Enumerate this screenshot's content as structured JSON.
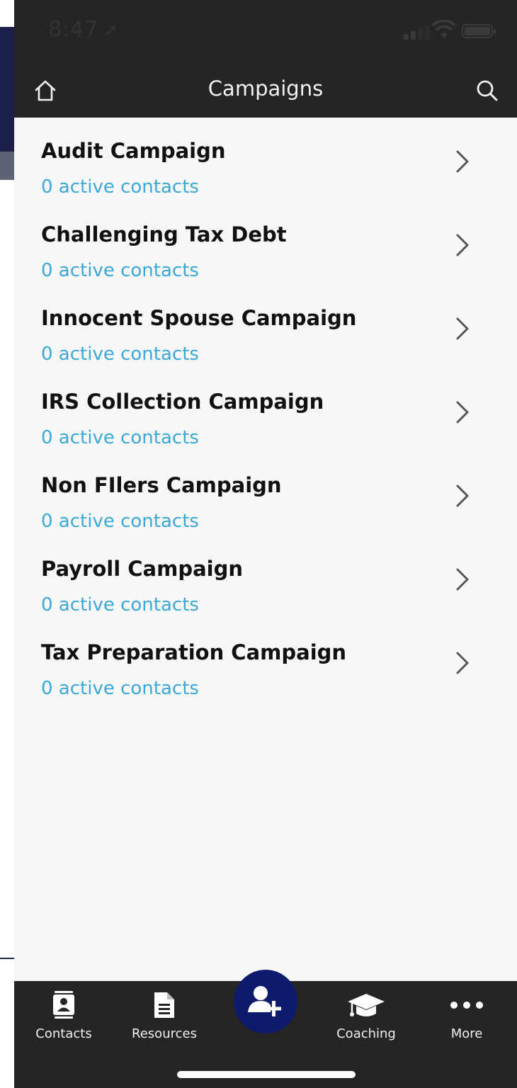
{
  "status_bar": {
    "time": "8:47",
    "location_glyph": "➚"
  },
  "nav": {
    "title": "Campaigns",
    "home_icon": "home-icon",
    "search_icon": "search-icon"
  },
  "campaigns": [
    {
      "name": "Audit Campaign",
      "subtitle": "0 active contacts"
    },
    {
      "name": "Challenging Tax Debt",
      "subtitle": "0 active contacts"
    },
    {
      "name": "Innocent Spouse Campaign",
      "subtitle": "0 active contacts"
    },
    {
      "name": "IRS Collection Campaign",
      "subtitle": "0 active contacts"
    },
    {
      "name": "Non FIlers Campaign",
      "subtitle": "0 active contacts"
    },
    {
      "name": "Payroll Campaign",
      "subtitle": "0 active contacts"
    },
    {
      "name": "Tax Preparation Campaign",
      "subtitle": "0 active contacts"
    }
  ],
  "tab_bar": {
    "contacts": "Contacts",
    "resources": "Resources",
    "coaching": "Coaching",
    "more": "More",
    "fab_icon": "add-contact-icon"
  },
  "colors": {
    "header_bg": "#252525",
    "list_bg": "#f8f7f8",
    "subtitle": "#3aa8d8",
    "fab": "#0d1a6e"
  }
}
